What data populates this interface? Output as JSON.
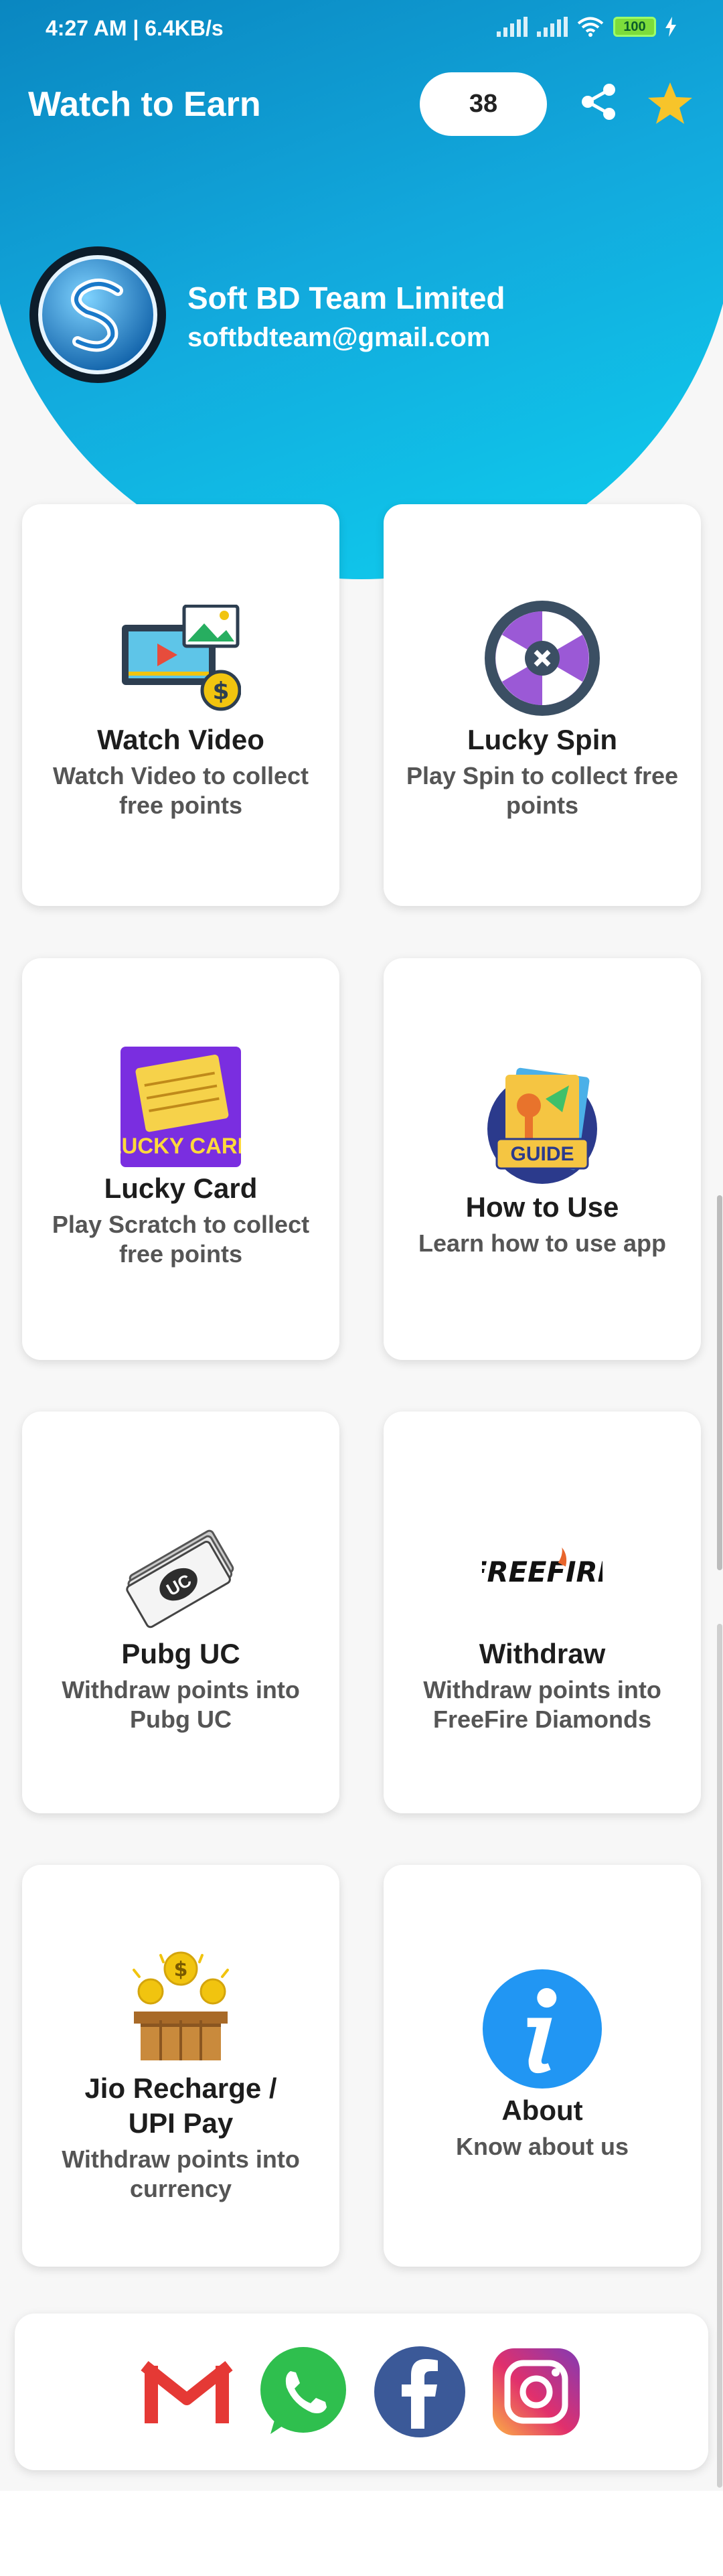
{
  "status_bar": {
    "time": "4:27 AM | 6.4KB/s",
    "battery": "100"
  },
  "header": {
    "title": "Watch to Earn",
    "points": "38"
  },
  "profile": {
    "name": "Soft BD Team Limited",
    "email": "softbdteam@gmail.com"
  },
  "cards": [
    {
      "title": "Watch Video",
      "subtitle": "Watch Video to collect free points",
      "icon": "video-coin-icon"
    },
    {
      "title": "Lucky Spin",
      "subtitle": "Play Spin to collect free points",
      "icon": "spin-wheel-icon"
    },
    {
      "title": "Lucky Card",
      "subtitle": "Play Scratch to collect free points",
      "icon": "lucky-card-icon",
      "icon_text": "LUCKY CARD"
    },
    {
      "title": "How to Use",
      "subtitle": "Learn how to use app",
      "icon": "guide-icon",
      "icon_text": "GUIDE"
    },
    {
      "title": "Pubg UC",
      "subtitle": "Withdraw points into Pubg UC",
      "icon": "uc-money-icon",
      "icon_text": "UC"
    },
    {
      "title": "Withdraw",
      "subtitle": "Withdraw points into FreeFire Diamonds",
      "icon": "freefire-logo-icon",
      "icon_text": "FREEFIRE"
    },
    {
      "title": "Jio Recharge / UPI Pay",
      "subtitle": "Withdraw points into currency",
      "icon": "treasure-coins-icon"
    },
    {
      "title": "About",
      "subtitle": "Know about us",
      "icon": "info-icon"
    }
  ],
  "social": [
    "gmail-icon",
    "whatsapp-icon",
    "facebook-icon",
    "instagram-icon"
  ],
  "colors": {
    "header_start": "#0a86c0",
    "header_end": "#0fd0ef",
    "star": "#f7c42a"
  }
}
